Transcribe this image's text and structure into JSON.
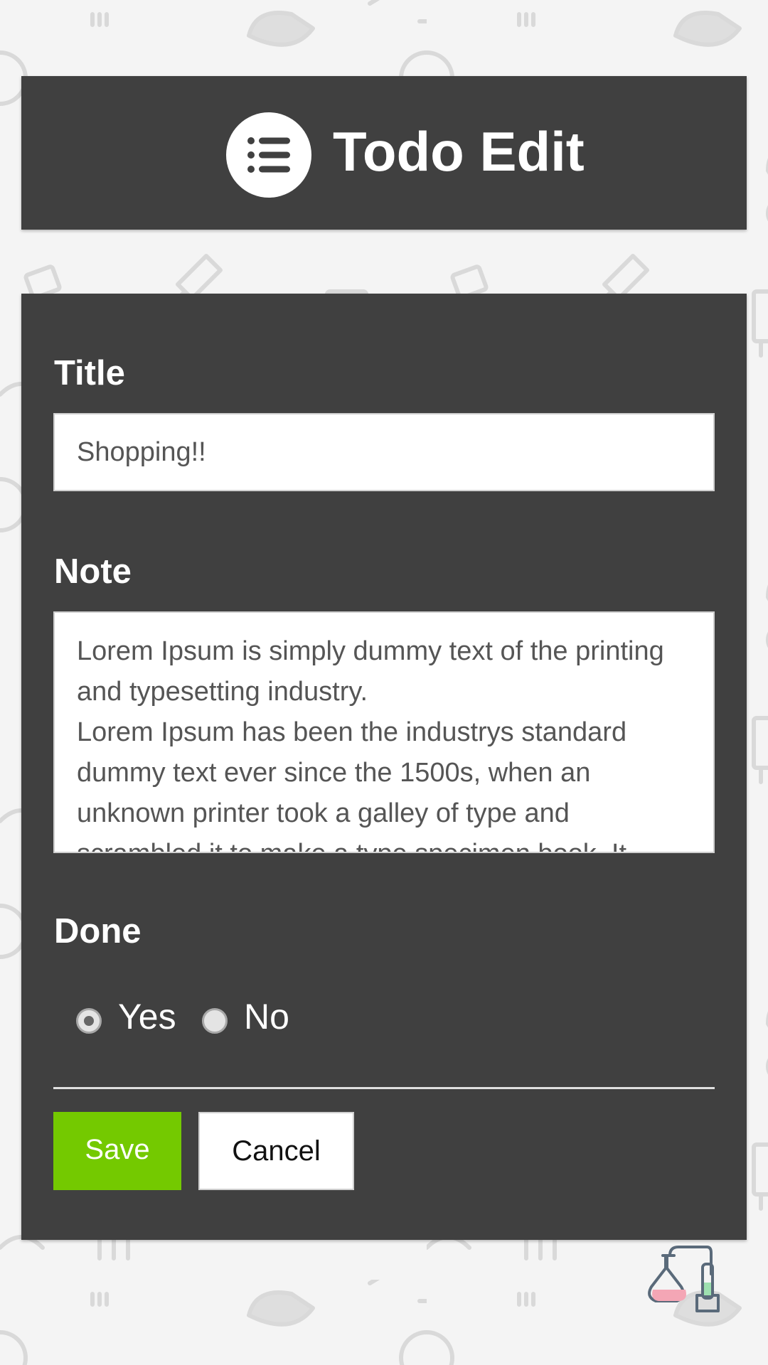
{
  "header": {
    "title": "Todo Edit",
    "icon": "list-icon"
  },
  "form": {
    "title_label": "Title",
    "title_value": "Shopping!!",
    "note_label": "Note",
    "note_value": "Lorem Ipsum is simply dummy text of the printing and typesetting industry.\nLorem Ipsum has been the industrys standard dummy text ever since the 1500s, when an unknown printer took a galley of type and scrambled it to make a type specimen book. It",
    "done_label": "Done",
    "done_options": [
      {
        "label": "Yes",
        "checked": true
      },
      {
        "label": "No",
        "checked": false
      }
    ]
  },
  "actions": {
    "save_label": "Save",
    "cancel_label": "Cancel"
  },
  "colors": {
    "panel": "#404040",
    "save_button": "#74c900",
    "background": "#f4f4f4"
  },
  "footer": {
    "logo_icon": "lab-flask-icon"
  }
}
